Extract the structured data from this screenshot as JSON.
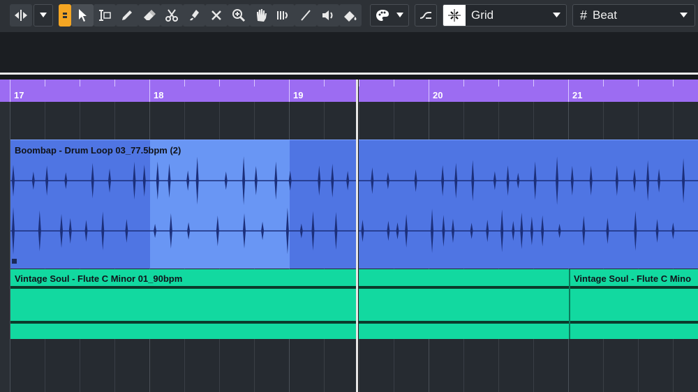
{
  "toolbar": {
    "tools": [
      "split-arrow-icon",
      "dropdown-arrow-icon",
      "handle-icon",
      "pointer-icon",
      "range-select-icon",
      "pencil-icon",
      "eraser-icon",
      "scissors-icon",
      "glue-icon",
      "mute-x-icon",
      "zoom-icon",
      "hand-icon",
      "timewarp-icon",
      "line-icon",
      "speaker-icon",
      "colorize-icon",
      "color-palette-icon",
      "dropdown-arrow-icon"
    ],
    "snap_label": "Grid",
    "grid_type_label": "Beat"
  },
  "ruler": {
    "bars": [
      "17",
      "18",
      "19",
      "20",
      "21"
    ],
    "color": "#9c6cf2"
  },
  "tracks": [
    {
      "name": "Boombap - Drum Loop 03_77.5bpm (2)",
      "color": "#4f75e3",
      "selected_color": "#6d9cf7"
    },
    {
      "name": "Vintage Soul - Flute C Minor 01_90bpm",
      "name_2": "Vintage Soul - Flute C Mino",
      "color": "#12d9a0"
    }
  ]
}
